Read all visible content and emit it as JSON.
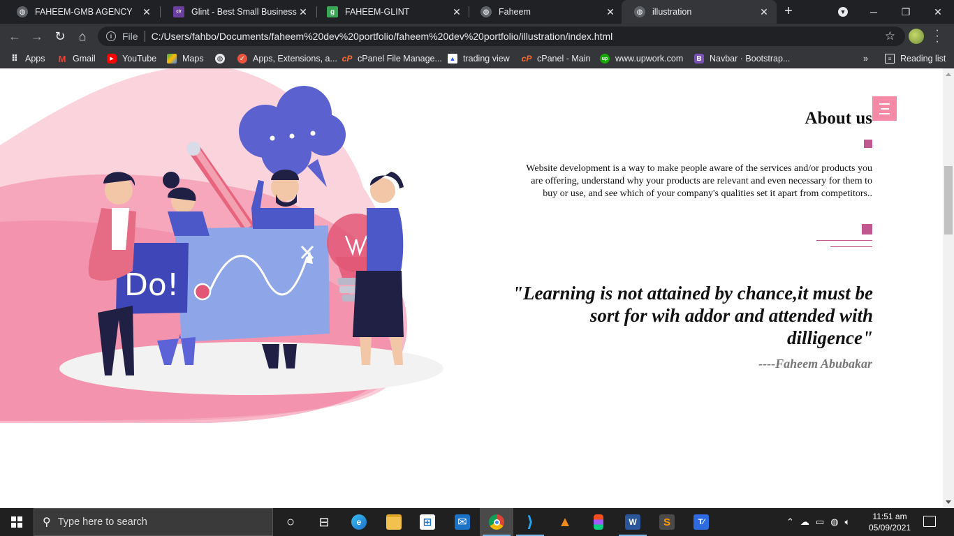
{
  "browser": {
    "tabs": [
      {
        "title": "FAHEEM-GMB AGENCY",
        "favicon": "globe-icon",
        "color": "#5f6368",
        "glyph": ""
      },
      {
        "title": "Glint - Best Small Business W",
        "favicon": "colorlib-icon",
        "color": "#6a3fa0",
        "glyph": ""
      },
      {
        "title": "FAHEEM-GLINT",
        "favicon": "glitch-icon",
        "color": "#3aa757",
        "glyph": "g"
      },
      {
        "title": "Faheem",
        "favicon": "globe-icon",
        "color": "#5f6368",
        "glyph": ""
      },
      {
        "title": "illustration",
        "favicon": "globe-icon",
        "color": "#5f6368",
        "glyph": ""
      }
    ],
    "active_tab": 4,
    "address": {
      "scheme_label": "File",
      "url": "C:/Users/fahbo/Documents/faheem%20dev%20portfolio/faheem%20dev%20portfolio/illustration/index.html"
    },
    "bookmarks": [
      {
        "label": "Apps",
        "icon": "apps-grid-icon",
        "color": "#e8eaed"
      },
      {
        "label": "Gmail",
        "icon": "gmail-icon",
        "color": "#ea4335"
      },
      {
        "label": "YouTube",
        "icon": "youtube-icon",
        "color": "#ff0000"
      },
      {
        "label": "Maps",
        "icon": "maps-icon",
        "color": "#34a853"
      },
      {
        "label": "",
        "icon": "globe-icon",
        "color": "#e8eaed"
      },
      {
        "label": "Apps, Extensions, a...",
        "icon": "extensions-icon",
        "color": "#e8553e"
      },
      {
        "label": "cPanel File Manage...",
        "icon": "cpanel-icon",
        "color": "#ff6c2c"
      },
      {
        "label": "trading view",
        "icon": "tradingview-icon",
        "color": "#2962ff"
      },
      {
        "label": "cPanel - Main",
        "icon": "cpanel-icon",
        "color": "#ff6c2c"
      },
      {
        "label": "www.upwork.com",
        "icon": "upwork-icon",
        "color": "#14a800"
      },
      {
        "label": "Navbar · Bootstrap...",
        "icon": "bootstrap-icon",
        "color": "#7952b3"
      }
    ],
    "more_bookmarks": "»",
    "reading_list": "Reading list"
  },
  "page": {
    "about_title": "About us",
    "about_text": "Website development is a way to make people aware of the services and/or products you are offering, understand why your products are relevant and even necessary for them to buy or use, and see which of your company's qualities set it apart from competitors..",
    "quote": "\"Learning is not attained by chance,it must be sort for wih addor and attended with dilligence\"",
    "quote_author": "----Faheem Abubakar",
    "illustration_text": "Do!",
    "accent_color": "#c0588f",
    "menu_color": "#f48aa6"
  },
  "taskbar": {
    "search_placeholder": "Type here to search",
    "apps": [
      {
        "name": "task-view-icon",
        "color": "transparent",
        "glyph": "○"
      },
      {
        "name": "multitask-icon",
        "color": "transparent",
        "glyph": "⊟"
      },
      {
        "name": "edge-icon",
        "color": "#1e88c9",
        "glyph": "e"
      },
      {
        "name": "file-explorer-icon",
        "color": "#f2c14e",
        "glyph": ""
      },
      {
        "name": "store-icon",
        "color": "#3a3a3a",
        "glyph": "⊞"
      },
      {
        "name": "mail-icon",
        "color": "#1a73c7",
        "glyph": "✉"
      },
      {
        "name": "chrome-icon",
        "color": "#dd4b39",
        "glyph": "◉"
      },
      {
        "name": "vscode-icon",
        "color": "#1f8ad2",
        "glyph": "⟩"
      },
      {
        "name": "vlc-icon",
        "color": "#f08a1a",
        "glyph": "▲"
      },
      {
        "name": "figma-icon",
        "color": "#a259ff",
        "glyph": "F"
      },
      {
        "name": "word-icon",
        "color": "#2b579a",
        "glyph": "W"
      },
      {
        "name": "sublime-icon",
        "color": "#ff9800",
        "glyph": "S"
      },
      {
        "name": "typora-icon",
        "color": "#2f6be0",
        "glyph": "T"
      }
    ],
    "active_app": 6,
    "time": "11:51 am",
    "date": "05/09/2021"
  }
}
